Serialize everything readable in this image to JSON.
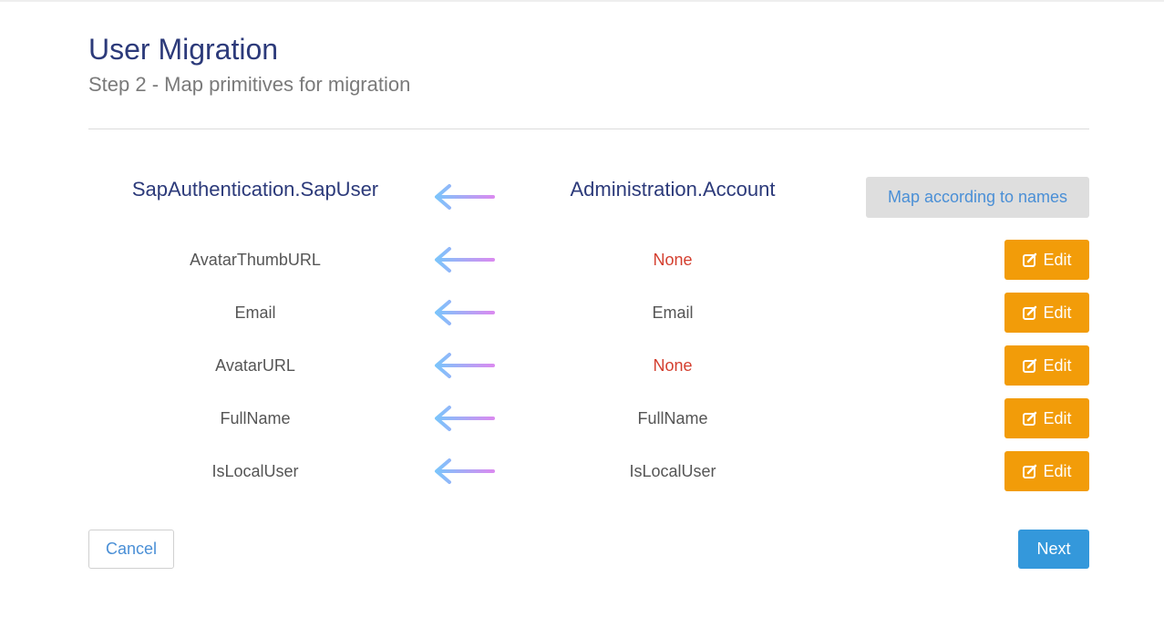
{
  "page": {
    "title": "User Migration",
    "subtitle": "Step 2 - Map primitives for migration"
  },
  "header": {
    "target": "SapAuthentication.SapUser",
    "source": "Administration.Account",
    "map_button_label": "Map according to names"
  },
  "mappings": [
    {
      "target": "AvatarThumbURL",
      "source": "None",
      "source_is_none": true,
      "edit_label": "Edit"
    },
    {
      "target": "Email",
      "source": "Email",
      "source_is_none": false,
      "edit_label": "Edit"
    },
    {
      "target": "AvatarURL",
      "source": "None",
      "source_is_none": true,
      "edit_label": "Edit"
    },
    {
      "target": "FullName",
      "source": "FullName",
      "source_is_none": false,
      "edit_label": "Edit"
    },
    {
      "target": "IsLocalUser",
      "source": "IsLocalUser",
      "source_is_none": false,
      "edit_label": "Edit"
    }
  ],
  "footer": {
    "cancel_label": "Cancel",
    "next_label": "Next"
  },
  "colors": {
    "title": "#2c3a7a",
    "edit_button": "#f29c09",
    "next_button": "#3498db",
    "none_text": "#d43f2f",
    "link_text": "#4a8fd6",
    "arrow_gradient": [
      "#7cc4fb",
      "#d98bf0"
    ]
  },
  "icons": {
    "arrow": "arrow-left-icon",
    "edit": "edit-icon"
  }
}
